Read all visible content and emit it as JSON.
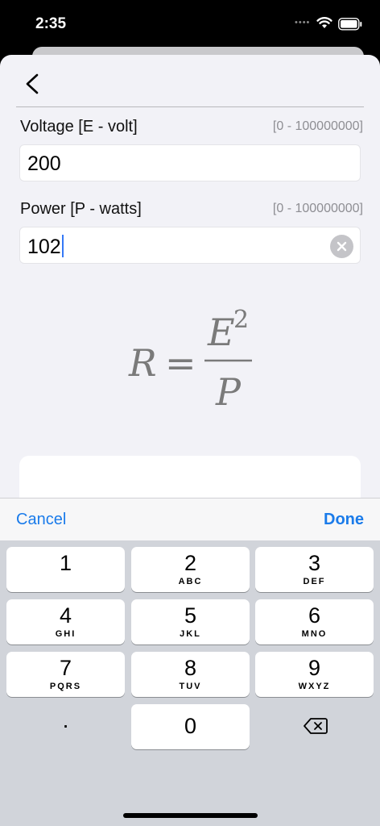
{
  "status": {
    "time": "2:35",
    "dots": "••••"
  },
  "form": {
    "voltage": {
      "label": "Voltage [E - volt]",
      "range": "[0 - 100000000]",
      "value": "200"
    },
    "power": {
      "label": "Power [P - watts]",
      "range": "[0 - 100000000]",
      "value": "102"
    }
  },
  "formula": {
    "lhs": "R",
    "equals": "=",
    "numerator": "E",
    "exponent": "2",
    "denominator": "P"
  },
  "toolbar": {
    "cancel_label": "Cancel",
    "done_label": "Done"
  },
  "keypad": {
    "keys": [
      {
        "digit": "1",
        "letters": ""
      },
      {
        "digit": "2",
        "letters": "ABC"
      },
      {
        "digit": "3",
        "letters": "DEF"
      },
      {
        "digit": "4",
        "letters": "GHI"
      },
      {
        "digit": "5",
        "letters": "JKL"
      },
      {
        "digit": "6",
        "letters": "MNO"
      },
      {
        "digit": "7",
        "letters": "PQRS"
      },
      {
        "digit": "8",
        "letters": "TUV"
      },
      {
        "digit": "9",
        "letters": "WXYZ"
      }
    ],
    "dot_label": ".",
    "zero_label": "0"
  },
  "icons": {
    "back": "chevron-left-icon",
    "clear": "clear-circle-icon",
    "delete": "backspace-icon",
    "wifi": "wifi-icon",
    "battery": "battery-icon"
  },
  "colors": {
    "accent": "#1a7bea",
    "caret": "#3478f6",
    "formula": "#7a7a7a"
  }
}
